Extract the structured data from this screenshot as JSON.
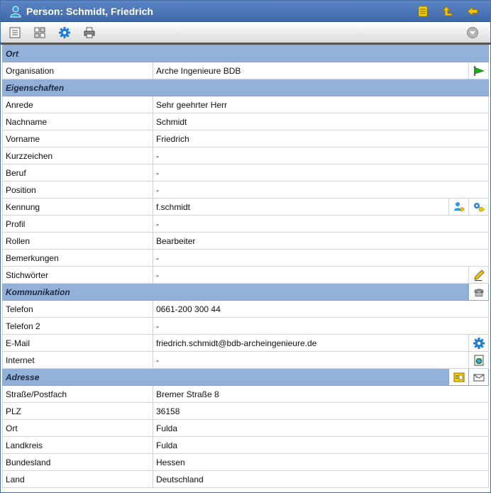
{
  "window": {
    "title": "Person: Schmidt, Friedrich"
  },
  "sections": {
    "ort": {
      "title": "Ort",
      "rows": [
        {
          "label": "Organisation",
          "value": "Arche Ingenieure BDB"
        }
      ]
    },
    "eigenschaften": {
      "title": "Eigenschaften",
      "rows": [
        {
          "label": "Anrede",
          "value": "Sehr geehrter Herr"
        },
        {
          "label": "Nachname",
          "value": "Schmidt"
        },
        {
          "label": "Vorname",
          "value": "Friedrich"
        },
        {
          "label": "Kurzzeichen",
          "value": "-"
        },
        {
          "label": "Beruf",
          "value": "-"
        },
        {
          "label": "Position",
          "value": "-"
        },
        {
          "label": "Kennung",
          "value": "f.schmidt"
        },
        {
          "label": "Profil",
          "value": "-"
        },
        {
          "label": "Rollen",
          "value": "Bearbeiter"
        },
        {
          "label": "Bemerkungen",
          "value": "-"
        },
        {
          "label": "Stichwörter",
          "value": "-"
        }
      ]
    },
    "kommunikation": {
      "title": "Kommunikation",
      "rows": [
        {
          "label": "Telefon",
          "value": "0661-200 300 44"
        },
        {
          "label": "Telefon 2",
          "value": "-"
        },
        {
          "label": "E-Mail",
          "value": "friedrich.schmidt@bdb-archeingenieure.de"
        },
        {
          "label": "Internet",
          "value": "-"
        }
      ]
    },
    "adresse": {
      "title": "Adresse",
      "rows": [
        {
          "label": "Straße/Postfach",
          "value": "Bremer Straße 8"
        },
        {
          "label": "PLZ",
          "value": "36158"
        },
        {
          "label": "Ort",
          "value": "Fulda"
        },
        {
          "label": "Landkreis",
          "value": "Fulda"
        },
        {
          "label": "Bundesland",
          "value": "Hessen"
        },
        {
          "label": "Land",
          "value": "Deutschland"
        }
      ]
    }
  },
  "colors": {
    "titlebar": "#4a74b4",
    "section": "#93b0d8",
    "accent": "#1e7fd8",
    "green": "#10a010",
    "yellow": "#f0c800"
  }
}
